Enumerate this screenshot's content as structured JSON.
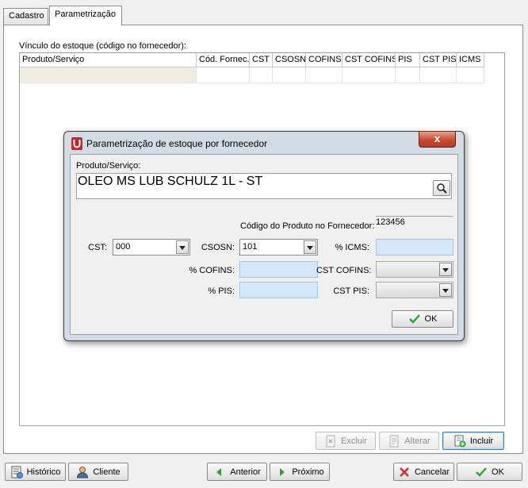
{
  "tabs": [
    {
      "label": "Cadastro",
      "active": false
    },
    {
      "label": "Parametrização",
      "active": true
    }
  ],
  "grid": {
    "label": "Vínculo do estoque  (código no fornecedor):",
    "columns": [
      "Produto/Serviço",
      "Cód. Fornec.",
      "CST",
      "CSOSN",
      "COFINS",
      "CST COFINS",
      "PIS",
      "CST PIS",
      "ICMS"
    ]
  },
  "grid_actions": {
    "excluir": "Excluir",
    "alterar": "Alterar",
    "incluir": "Incluir"
  },
  "footer": {
    "historico": "Histórico",
    "cliente": "Cliente",
    "anterior": "Anterior",
    "proximo": "Próximo",
    "cancelar": "Cancelar",
    "ok": "OK"
  },
  "dialog": {
    "title": "Parametrização de estoque por fornecedor",
    "close": "x",
    "produto_label": "Produto/Serviço:",
    "produto_value": "OLEO MS LUB SCHULZ 1L - ST",
    "codigo_label": "Código do Produto no Fornecedor:",
    "codigo_value": "123456",
    "cst_label": "CST:",
    "cst_value": "000",
    "csosn_label": "CSOSN:",
    "csosn_value": "101",
    "icms_label": "% ICMS:",
    "icms_value": "",
    "cofins_label": "% COFINS:",
    "cofins_value": "",
    "cst_cofins_label": "CST COFINS:",
    "cst_cofins_value": "",
    "pis_label": "% PIS:",
    "pis_value": "",
    "cst_pis_label": "CST PIS:",
    "cst_pis_value": "",
    "ok": "OK"
  },
  "colors": {
    "field_bg": "#d4e8fc",
    "close_red": "#c74b33",
    "check_green": "#2aa52a",
    "cancel_red": "#d8272d"
  },
  "icons": [
    "search-icon",
    "check-icon",
    "x-icon",
    "arrow-left-icon",
    "arrow-right-icon",
    "user-icon",
    "history-icon",
    "add-doc-icon",
    "edit-doc-icon",
    "delete-doc-icon",
    "app-logo-icon"
  ]
}
